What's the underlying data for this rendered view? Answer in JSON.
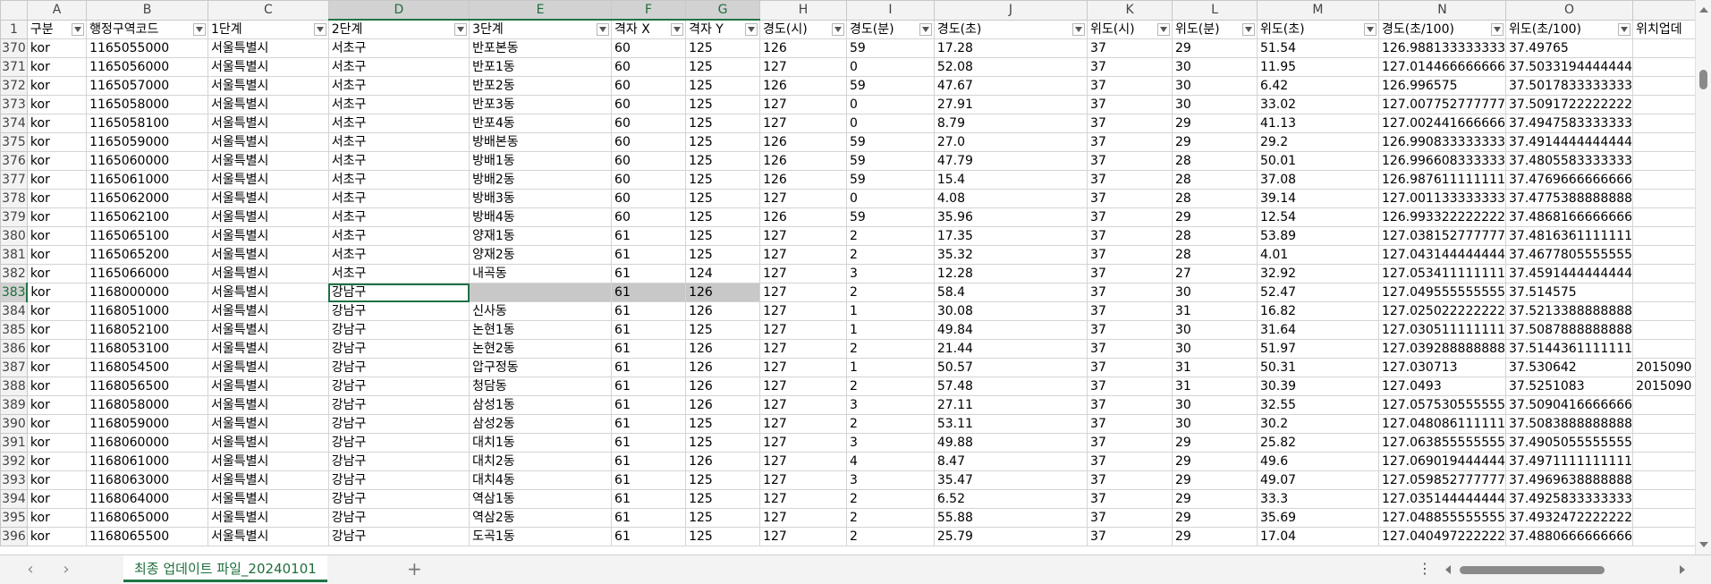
{
  "columns": [
    "A",
    "B",
    "C",
    "D",
    "E",
    "F",
    "G",
    "H",
    "I",
    "J",
    "K",
    "L",
    "M",
    "N",
    "O"
  ],
  "selected_column_letters": [
    "D",
    "E",
    "F",
    "G"
  ],
  "header_row": {
    "row_number": "1",
    "cells": [
      "구분",
      "행정구역코드",
      "1단계",
      "2단계",
      "3단계",
      "격자 X",
      "격자 Y",
      "경도(시)",
      "경도(분)",
      "경도(초)",
      "위도(시)",
      "위도(분)",
      "위도(초)",
      "경도(초/100)",
      "위도(초/100)",
      "위치업데"
    ]
  },
  "rows": [
    {
      "n": "370",
      "c": [
        "kor",
        "1165055000",
        "서울특별시",
        "서초구",
        "반포본동",
        "60",
        "125",
        "126",
        "59",
        "17.28",
        "37",
        "29",
        "51.54",
        "126.988133333333",
        "37.49765",
        ""
      ]
    },
    {
      "n": "371",
      "c": [
        "kor",
        "1165056000",
        "서울특별시",
        "서초구",
        "반포1동",
        "60",
        "125",
        "127",
        "0",
        "52.08",
        "37",
        "30",
        "11.95",
        "127.014466666666",
        "37.5033194444444",
        ""
      ]
    },
    {
      "n": "372",
      "c": [
        "kor",
        "1165057000",
        "서울특별시",
        "서초구",
        "반포2동",
        "60",
        "125",
        "126",
        "59",
        "47.67",
        "37",
        "30",
        "6.42",
        "126.996575",
        "37.5017833333333",
        ""
      ]
    },
    {
      "n": "373",
      "c": [
        "kor",
        "1165058000",
        "서울특별시",
        "서초구",
        "반포3동",
        "60",
        "125",
        "127",
        "0",
        "27.91",
        "37",
        "30",
        "33.02",
        "127.007752777777",
        "37.5091722222222",
        ""
      ]
    },
    {
      "n": "374",
      "c": [
        "kor",
        "1165058100",
        "서울특별시",
        "서초구",
        "반포4동",
        "60",
        "125",
        "127",
        "0",
        "8.79",
        "37",
        "29",
        "41.13",
        "127.002441666666",
        "37.4947583333333",
        ""
      ]
    },
    {
      "n": "375",
      "c": [
        "kor",
        "1165059000",
        "서울특별시",
        "서초구",
        "방배본동",
        "60",
        "125",
        "126",
        "59",
        "27.0",
        "37",
        "29",
        "29.2",
        "126.990833333333",
        "37.4914444444444",
        ""
      ]
    },
    {
      "n": "376",
      "c": [
        "kor",
        "1165060000",
        "서울특별시",
        "서초구",
        "방배1동",
        "60",
        "125",
        "126",
        "59",
        "47.79",
        "37",
        "28",
        "50.01",
        "126.996608333333",
        "37.4805583333333",
        ""
      ]
    },
    {
      "n": "377",
      "c": [
        "kor",
        "1165061000",
        "서울특별시",
        "서초구",
        "방배2동",
        "60",
        "125",
        "126",
        "59",
        "15.4",
        "37",
        "28",
        "37.08",
        "126.987611111111",
        "37.4769666666666",
        ""
      ]
    },
    {
      "n": "378",
      "c": [
        "kor",
        "1165062000",
        "서울특별시",
        "서초구",
        "방배3동",
        "60",
        "125",
        "127",
        "0",
        "4.08",
        "37",
        "28",
        "39.14",
        "127.001133333333",
        "37.4775388888888",
        ""
      ]
    },
    {
      "n": "379",
      "c": [
        "kor",
        "1165062100",
        "서울특별시",
        "서초구",
        "방배4동",
        "60",
        "125",
        "126",
        "59",
        "35.96",
        "37",
        "29",
        "12.54",
        "126.993322222222",
        "37.4868166666666",
        ""
      ]
    },
    {
      "n": "380",
      "c": [
        "kor",
        "1165065100",
        "서울특별시",
        "서초구",
        "양재1동",
        "61",
        "125",
        "127",
        "2",
        "17.35",
        "37",
        "28",
        "53.89",
        "127.038152777777",
        "37.4816361111111",
        ""
      ]
    },
    {
      "n": "381",
      "c": [
        "kor",
        "1165065200",
        "서울특별시",
        "서초구",
        "양재2동",
        "61",
        "125",
        "127",
        "2",
        "35.32",
        "37",
        "28",
        "4.01",
        "127.043144444444",
        "37.4677805555555",
        ""
      ]
    },
    {
      "n": "382",
      "c": [
        "kor",
        "1165066000",
        "서울특별시",
        "서초구",
        "내곡동",
        "61",
        "124",
        "127",
        "3",
        "12.28",
        "37",
        "27",
        "32.92",
        "127.053411111111",
        "37.4591444444444",
        ""
      ]
    },
    {
      "n": "383",
      "c": [
        "kor",
        "1168000000",
        "서울특별시",
        "강남구",
        "",
        "61",
        "126",
        "127",
        "2",
        "58.4",
        "37",
        "30",
        "52.47",
        "127.049555555555",
        "37.514575",
        ""
      ]
    },
    {
      "n": "384",
      "c": [
        "kor",
        "1168051000",
        "서울특별시",
        "강남구",
        "신사동",
        "61",
        "126",
        "127",
        "1",
        "30.08",
        "37",
        "31",
        "16.82",
        "127.025022222222",
        "37.5213388888888",
        ""
      ]
    },
    {
      "n": "385",
      "c": [
        "kor",
        "1168052100",
        "서울특별시",
        "강남구",
        "논현1동",
        "61",
        "125",
        "127",
        "1",
        "49.84",
        "37",
        "30",
        "31.64",
        "127.030511111111",
        "37.5087888888888",
        ""
      ]
    },
    {
      "n": "386",
      "c": [
        "kor",
        "1168053100",
        "서울특별시",
        "강남구",
        "논현2동",
        "61",
        "126",
        "127",
        "2",
        "21.44",
        "37",
        "30",
        "51.97",
        "127.039288888888",
        "37.5144361111111",
        ""
      ]
    },
    {
      "n": "387",
      "c": [
        "kor",
        "1168054500",
        "서울특별시",
        "강남구",
        "압구정동",
        "61",
        "126",
        "127",
        "1",
        "50.57",
        "37",
        "31",
        "50.31",
        "127.030713",
        "37.530642",
        "2015090"
      ]
    },
    {
      "n": "388",
      "c": [
        "kor",
        "1168056500",
        "서울특별시",
        "강남구",
        "청담동",
        "61",
        "126",
        "127",
        "2",
        "57.48",
        "37",
        "31",
        "30.39",
        "127.0493",
        "37.5251083",
        "2015090"
      ]
    },
    {
      "n": "389",
      "c": [
        "kor",
        "1168058000",
        "서울특별시",
        "강남구",
        "삼성1동",
        "61",
        "126",
        "127",
        "3",
        "27.11",
        "37",
        "30",
        "32.55",
        "127.057530555555",
        "37.5090416666666",
        ""
      ]
    },
    {
      "n": "390",
      "c": [
        "kor",
        "1168059000",
        "서울특별시",
        "강남구",
        "삼성2동",
        "61",
        "125",
        "127",
        "2",
        "53.11",
        "37",
        "30",
        "30.2",
        "127.048086111111",
        "37.5083888888888",
        ""
      ]
    },
    {
      "n": "391",
      "c": [
        "kor",
        "1168060000",
        "서울특별시",
        "강남구",
        "대치1동",
        "61",
        "125",
        "127",
        "3",
        "49.88",
        "37",
        "29",
        "25.82",
        "127.063855555555",
        "37.4905055555555",
        ""
      ]
    },
    {
      "n": "392",
      "c": [
        "kor",
        "1168061000",
        "서울특별시",
        "강남구",
        "대치2동",
        "61",
        "126",
        "127",
        "4",
        "8.47",
        "37",
        "29",
        "49.6",
        "127.069019444444",
        "37.4971111111111",
        ""
      ]
    },
    {
      "n": "393",
      "c": [
        "kor",
        "1168063000",
        "서울특별시",
        "강남구",
        "대치4동",
        "61",
        "125",
        "127",
        "3",
        "35.47",
        "37",
        "29",
        "49.07",
        "127.059852777777",
        "37.4969638888888",
        ""
      ]
    },
    {
      "n": "394",
      "c": [
        "kor",
        "1168064000",
        "서울특별시",
        "강남구",
        "역삼1동",
        "61",
        "125",
        "127",
        "2",
        "6.52",
        "37",
        "29",
        "33.3",
        "127.035144444444",
        "37.4925833333333",
        ""
      ]
    },
    {
      "n": "395",
      "c": [
        "kor",
        "1168065000",
        "서울특별시",
        "강남구",
        "역삼2동",
        "61",
        "125",
        "127",
        "2",
        "55.88",
        "37",
        "29",
        "35.69",
        "127.048855555555",
        "37.4932472222222",
        ""
      ]
    },
    {
      "n": "396",
      "c": [
        "kor",
        "1168065500",
        "서울특별시",
        "강남구",
        "도곡1동",
        "61",
        "125",
        "127",
        "2",
        "25.79",
        "37",
        "29",
        "17.04",
        "127.040497222222",
        "37.4880666666666",
        ""
      ]
    }
  ],
  "sheet_tab": "최종 업데이트 파일_20240101",
  "nav": {
    "prev": "‹",
    "next": "›",
    "add": "+",
    "more": "⋮"
  },
  "colors": {
    "accent": "#217346",
    "header_bg": "#f3f3f3",
    "selected_header_bg": "#d2d2d2",
    "grey_cell": "#c8c8c8"
  }
}
